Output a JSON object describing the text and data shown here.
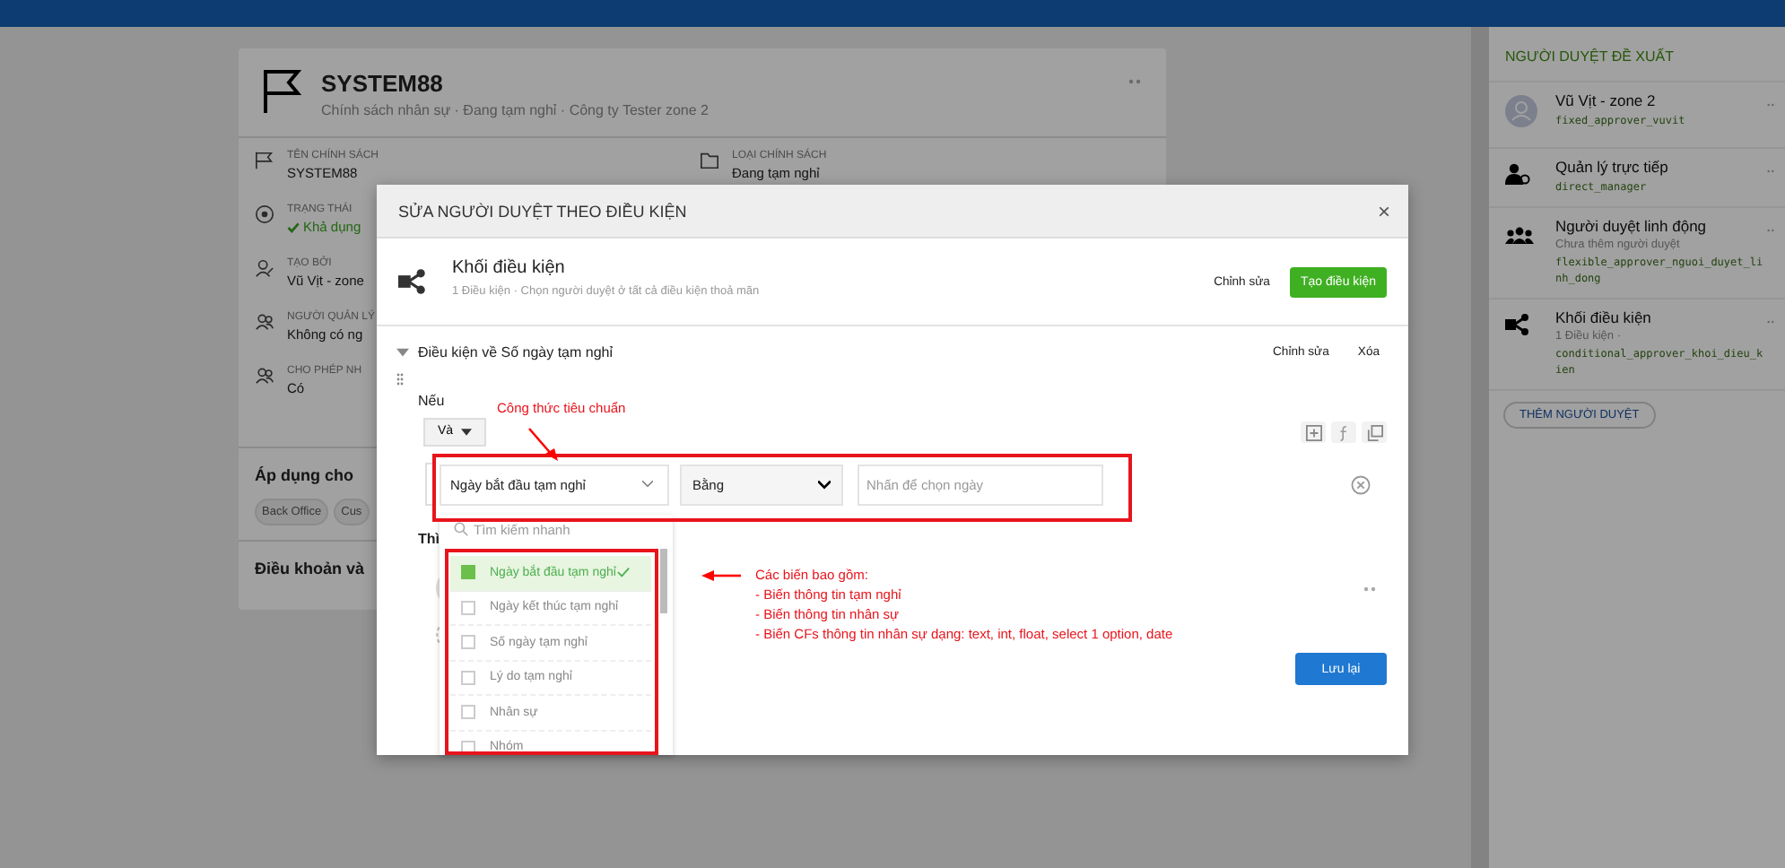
{
  "policy": {
    "title": "SYSTEM88",
    "subtitle": "Chính sách nhân sự · Đang tạm nghỉ · Công ty Tester zone 2",
    "fields_left": [
      {
        "kind": "flag",
        "label": "TÊN CHÍNH SÁCH",
        "value": "SYSTEM88"
      },
      {
        "kind": "status",
        "label": "TRẠNG THÁI",
        "value": "Khả dụng"
      },
      {
        "kind": "user",
        "label": "TẠO BỞI",
        "value": "Vũ Vịt - zone"
      },
      {
        "kind": "users",
        "label": "NGƯỜI QUẢN LÝ",
        "value": "Không có ng"
      },
      {
        "kind": "users",
        "label": "CHO PHÉP NH",
        "value": "Có"
      }
    ],
    "fields_right": [
      {
        "kind": "folder",
        "label": "LOẠI CHÍNH SÁCH",
        "value": "Đang tạm nghỉ"
      }
    ],
    "apply_title": "Áp dụng cho",
    "tags": [
      "Back Office",
      "Cus"
    ],
    "terms_title": "Điều khoản và"
  },
  "modal": {
    "title": "SỬA NGƯỜI DUYỆT THEO ĐIỀU KIỆN",
    "close": "×",
    "block": {
      "title": "Khối điều kiện",
      "subtitle": "1 Điều kiện · Chọn người duyệt ở tất cả điều kiện thoả mãn",
      "edit_label": "Chỉnh sửa",
      "create_label": "Tạo điều kiện"
    },
    "condition": {
      "title": "Điều kiện về Số ngày tạm nghỉ",
      "expanded": true,
      "edit_label": "Chỉnh sửa",
      "delete_label": "Xóa",
      "if_label": "Nếu",
      "operator": "Và",
      "field": "Ngày bắt đầu tạm nghỉ",
      "comparison": "Bằng",
      "value_placeholder": "Nhấn để chọn ngày",
      "then_label": "Thì"
    },
    "dropdown": {
      "search_placeholder": "Tìm kiếm nhanh",
      "options": [
        {
          "label": "Ngày bắt đầu tạm nghỉ",
          "selected": true
        },
        {
          "label": "Ngày kết thúc tạm nghỉ",
          "selected": false
        },
        {
          "label": "Số ngày tạm nghỉ",
          "selected": false
        },
        {
          "label": "Lý do tạm nghỉ",
          "selected": false
        },
        {
          "label": "Nhân sự",
          "selected": false
        },
        {
          "label": "Nhóm",
          "selected": false
        }
      ]
    },
    "save_label": "Lưu lại"
  },
  "annotations": {
    "formula_note": "Công thức tiêu chuẩn",
    "variables_note": [
      "Các biến bao gồm:",
      "- Biến thông tin tạm nghỉ",
      "- Biến thông tin nhân sự",
      "- Biến CFs thông tin nhân sự dạng: text, int, float, select 1 option, date"
    ]
  },
  "sidebar": {
    "title": "NGƯỜI DUYỆT ĐỀ XUẤT",
    "approvers": [
      {
        "kind": "person",
        "name": "Vũ Vịt - zone 2",
        "code": "fixed_approver_vuvit"
      },
      {
        "kind": "manager",
        "name": "Quản lý trực tiếp",
        "code": "direct_manager"
      },
      {
        "kind": "group",
        "name": "Người duyệt linh động",
        "description": "Chưa thêm người duyệt",
        "code": "flexible_approver_nguoi_duyet_linh_dong"
      },
      {
        "kind": "conditional",
        "name": "Khối điều kiện",
        "description": "1 Điều kiện ·",
        "code": "conditional_approver_khoi_dieu_kien"
      }
    ],
    "add_label": "THÊM NGƯỜI DUYỆT"
  }
}
